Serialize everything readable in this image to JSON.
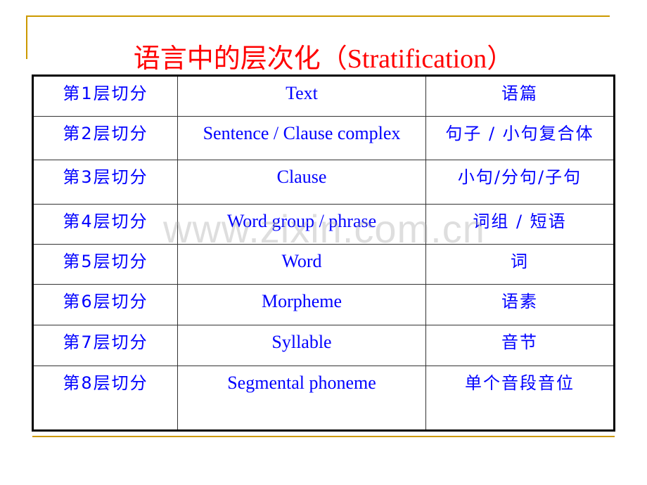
{
  "slide": {
    "title_zh": "语言中的层次化（",
    "title_en": "Stratification",
    "title_close": "）",
    "colors": {
      "title": "#ff0000",
      "body_text": "#0000ff",
      "accent_rule": "#cc9900",
      "table_border": "#000000"
    }
  },
  "table": {
    "rows": [
      {
        "level": "第1层切分",
        "english": "Text",
        "chinese": "语篇"
      },
      {
        "level": "第2层切分",
        "english": "Sentence / Clause complex",
        "chinese": "句子 / 小句复合体"
      },
      {
        "level": "第3层切分",
        "english": "Clause",
        "chinese": "小句/分句/子句"
      },
      {
        "level": "第4层切分",
        "english": "Word group / phrase",
        "chinese": "词组 / 短语"
      },
      {
        "level": "第5层切分",
        "english": "Word",
        "chinese": "词"
      },
      {
        "level": "第6层切分",
        "english": "Morpheme",
        "chinese": "语素"
      },
      {
        "level": "第7层切分",
        "english": "Syllable",
        "chinese": "音节"
      },
      {
        "level": "第8层切分",
        "english": "Segmental phoneme",
        "chinese": "单个音段音位"
      }
    ]
  },
  "watermark": "www.zixin.com.cn"
}
